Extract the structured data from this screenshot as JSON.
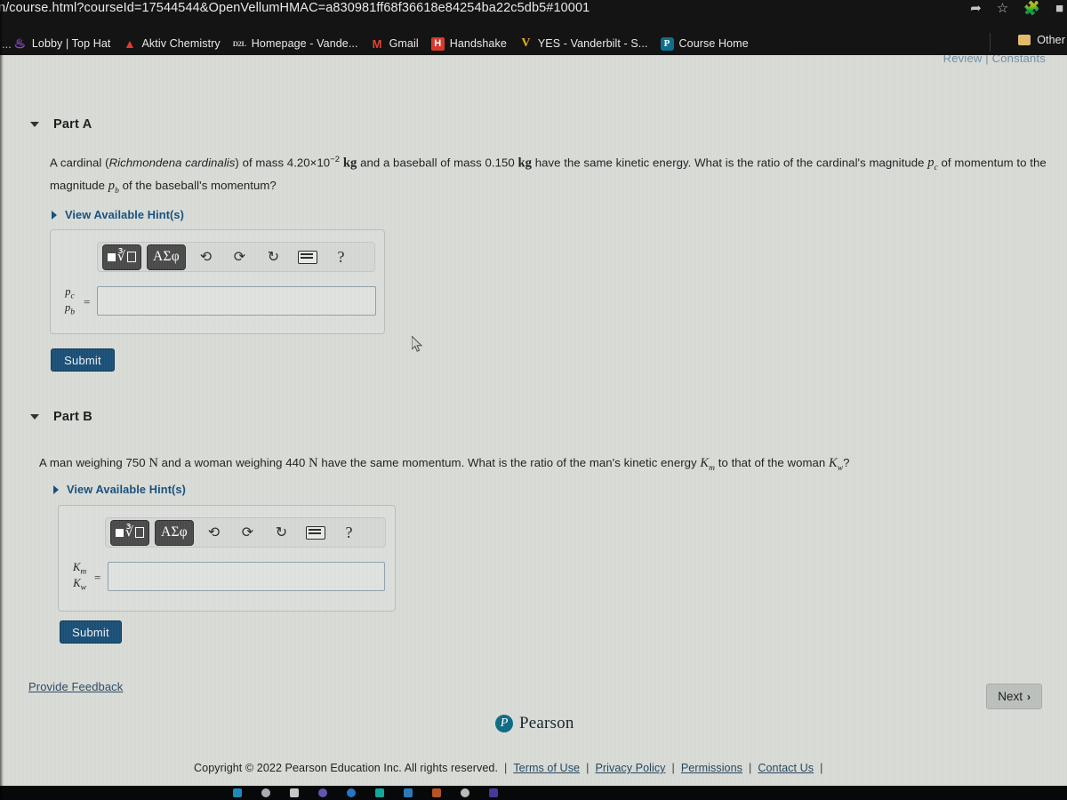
{
  "browser": {
    "url": "n/course.html?courseId=17544544&OpenVellumHMAC=a830981ff68f36618e84254ba22c5db5#10001",
    "url_icons": [
      "share-icon",
      "star-icon",
      "extensions-icon",
      "profile-icon"
    ],
    "bookmarks_overflow": "...",
    "bookmarks": [
      {
        "label": "Lobby | Top Hat",
        "icon": "tophat-favicon"
      },
      {
        "label": "Aktiv Chemistry",
        "icon": "aktiv-favicon"
      },
      {
        "label": "Homepage - Vande...",
        "icon": "d2l-favicon"
      },
      {
        "label": "Gmail",
        "icon": "gmail-favicon"
      },
      {
        "label": "Handshake",
        "icon": "handshake-favicon"
      },
      {
        "label": "YES - Vanderbilt - S...",
        "icon": "yes-favicon"
      },
      {
        "label": "Course Home",
        "icon": "pearson-favicon"
      }
    ],
    "other_bookmarks": "Other",
    "other_bookmarks_icon": "folder-icon"
  },
  "page": {
    "cut_off_header": "Review | Constants",
    "parts": [
      {
        "id": "part-a",
        "title": "Part A",
        "question_html": "A cardinal (<i>Richmondena cardinalis</i>) of mass 4.20&#215;10<sup class=\"msup\">&#8722;2</sup> <span class=\"mathbf\">kg</span> and a baseball of mass 0.150 <span class=\"mathbf\">kg</span> have the same kinetic energy. What is the ratio of the cardinal's magnitude <span class=\"mathit\">p<sub class=\"msub\">c</sub></span> of momentum to the magnitude <span class=\"mathit\">p<sub class=\"msub\">b</sub></span> of the baseball's momentum?",
        "hint_label": "View Available Hint(s)",
        "answer_numerator": "p",
        "answer_numerator_sub": "c",
        "answer_denominator": "p",
        "answer_denominator_sub": "b",
        "equals": "=",
        "answer_value": "",
        "submit_label": "Submit"
      },
      {
        "id": "part-b",
        "title": "Part B",
        "question_html": "A man weighing 750 <span class=\"mathup\">N</span> and a woman weighing 440 <span class=\"mathup\">N</span> have the same momentum. What is the ratio of the man's kinetic energy <span class=\"mathit\">K<sub class=\"msub\">m</sub></span> to that of the woman <span class=\"mathit\">K<sub class=\"msub\">w</sub></span>?",
        "hint_label": "View Available Hint(s)",
        "answer_numerator": "K",
        "answer_numerator_sub": "m",
        "answer_denominator": "K",
        "answer_denominator_sub": "w",
        "equals": "=",
        "answer_value": "",
        "submit_label": "Submit"
      }
    ],
    "toolbar": {
      "template_button": "math-template-button",
      "greek_button": "ΑΣφ",
      "undo": "undo-icon",
      "redo": "redo-icon",
      "reset": "reset-icon",
      "keyboard": "keyboard-icon",
      "help": "?"
    },
    "feedback_link": "Provide Feedback",
    "next_button": "Next",
    "next_chevron": "›",
    "pearson": {
      "mark": "P",
      "word": "Pearson"
    },
    "footer": {
      "copyright": "Copyright © 2022 Pearson Education Inc. All rights reserved.",
      "links": [
        "Terms of Use",
        "Privacy Policy",
        "Permissions",
        "Contact Us"
      ]
    }
  },
  "colors": {
    "accent_blue": "#14507d",
    "submit_blue": "#1a4f77",
    "page_bg": "#d9dbd7",
    "chrome_bg": "#141414"
  }
}
